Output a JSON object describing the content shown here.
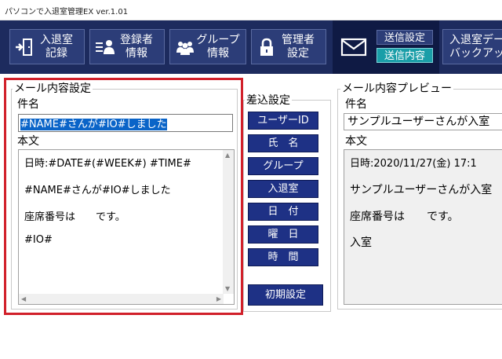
{
  "window": {
    "title": "パソコンで入退室管理EX ver.1.01"
  },
  "toolbar": {
    "entry_record": {
      "line1": "入退室",
      "line2": "記録"
    },
    "registrant_info": {
      "line1": "登録者",
      "line2": "情報"
    },
    "group_info": {
      "line1": "グループ",
      "line2": "情報"
    },
    "admin_settings": {
      "line1": "管理者",
      "line2": "設定"
    },
    "mail": {
      "send_settings": "送信設定",
      "send_content": "送信内容"
    },
    "backup": {
      "line1": "入退室デー",
      "line2": "バックアッ"
    }
  },
  "mail_settings": {
    "title": "メール内容設定",
    "subject_label": "件名",
    "subject_value": "#NAME#さんが#IO#しました",
    "body_label": "本文",
    "body_lines": [
      "日時:#DATE#(#WEEK#) #TIME#",
      "#NAME#さんが#IO#しました",
      "座席番号は　　です。",
      "#IO#"
    ]
  },
  "insert_settings": {
    "title": "差込設定",
    "buttons": [
      "ユーザーID",
      "氏　名",
      "グループ",
      "入退室",
      "日　付",
      "曜　日",
      "時　間"
    ],
    "reset_label": "初期設定"
  },
  "preview": {
    "title": "メール内容プレビュー",
    "subject_label": "件名",
    "subject_value": "サンプルユーザーさんが入室",
    "body_label": "本文",
    "body_lines": [
      "日時:2020/11/27(金) 17:1",
      "サンプルユーザーさんが入室",
      "座席番号は　　です。",
      "入室"
    ]
  },
  "colors": {
    "toolbar_bg": "#1d2b5e",
    "button_bg": "#2c3d78",
    "active_tab": "#1a9ea8",
    "highlight_frame": "#d1202a",
    "insert_button": "#1e3185",
    "selection": "#0a64c8"
  },
  "icons": [
    "door-exit-icon",
    "id-card-icon",
    "group-people-icon",
    "padlock-icon",
    "envelope-icon"
  ]
}
